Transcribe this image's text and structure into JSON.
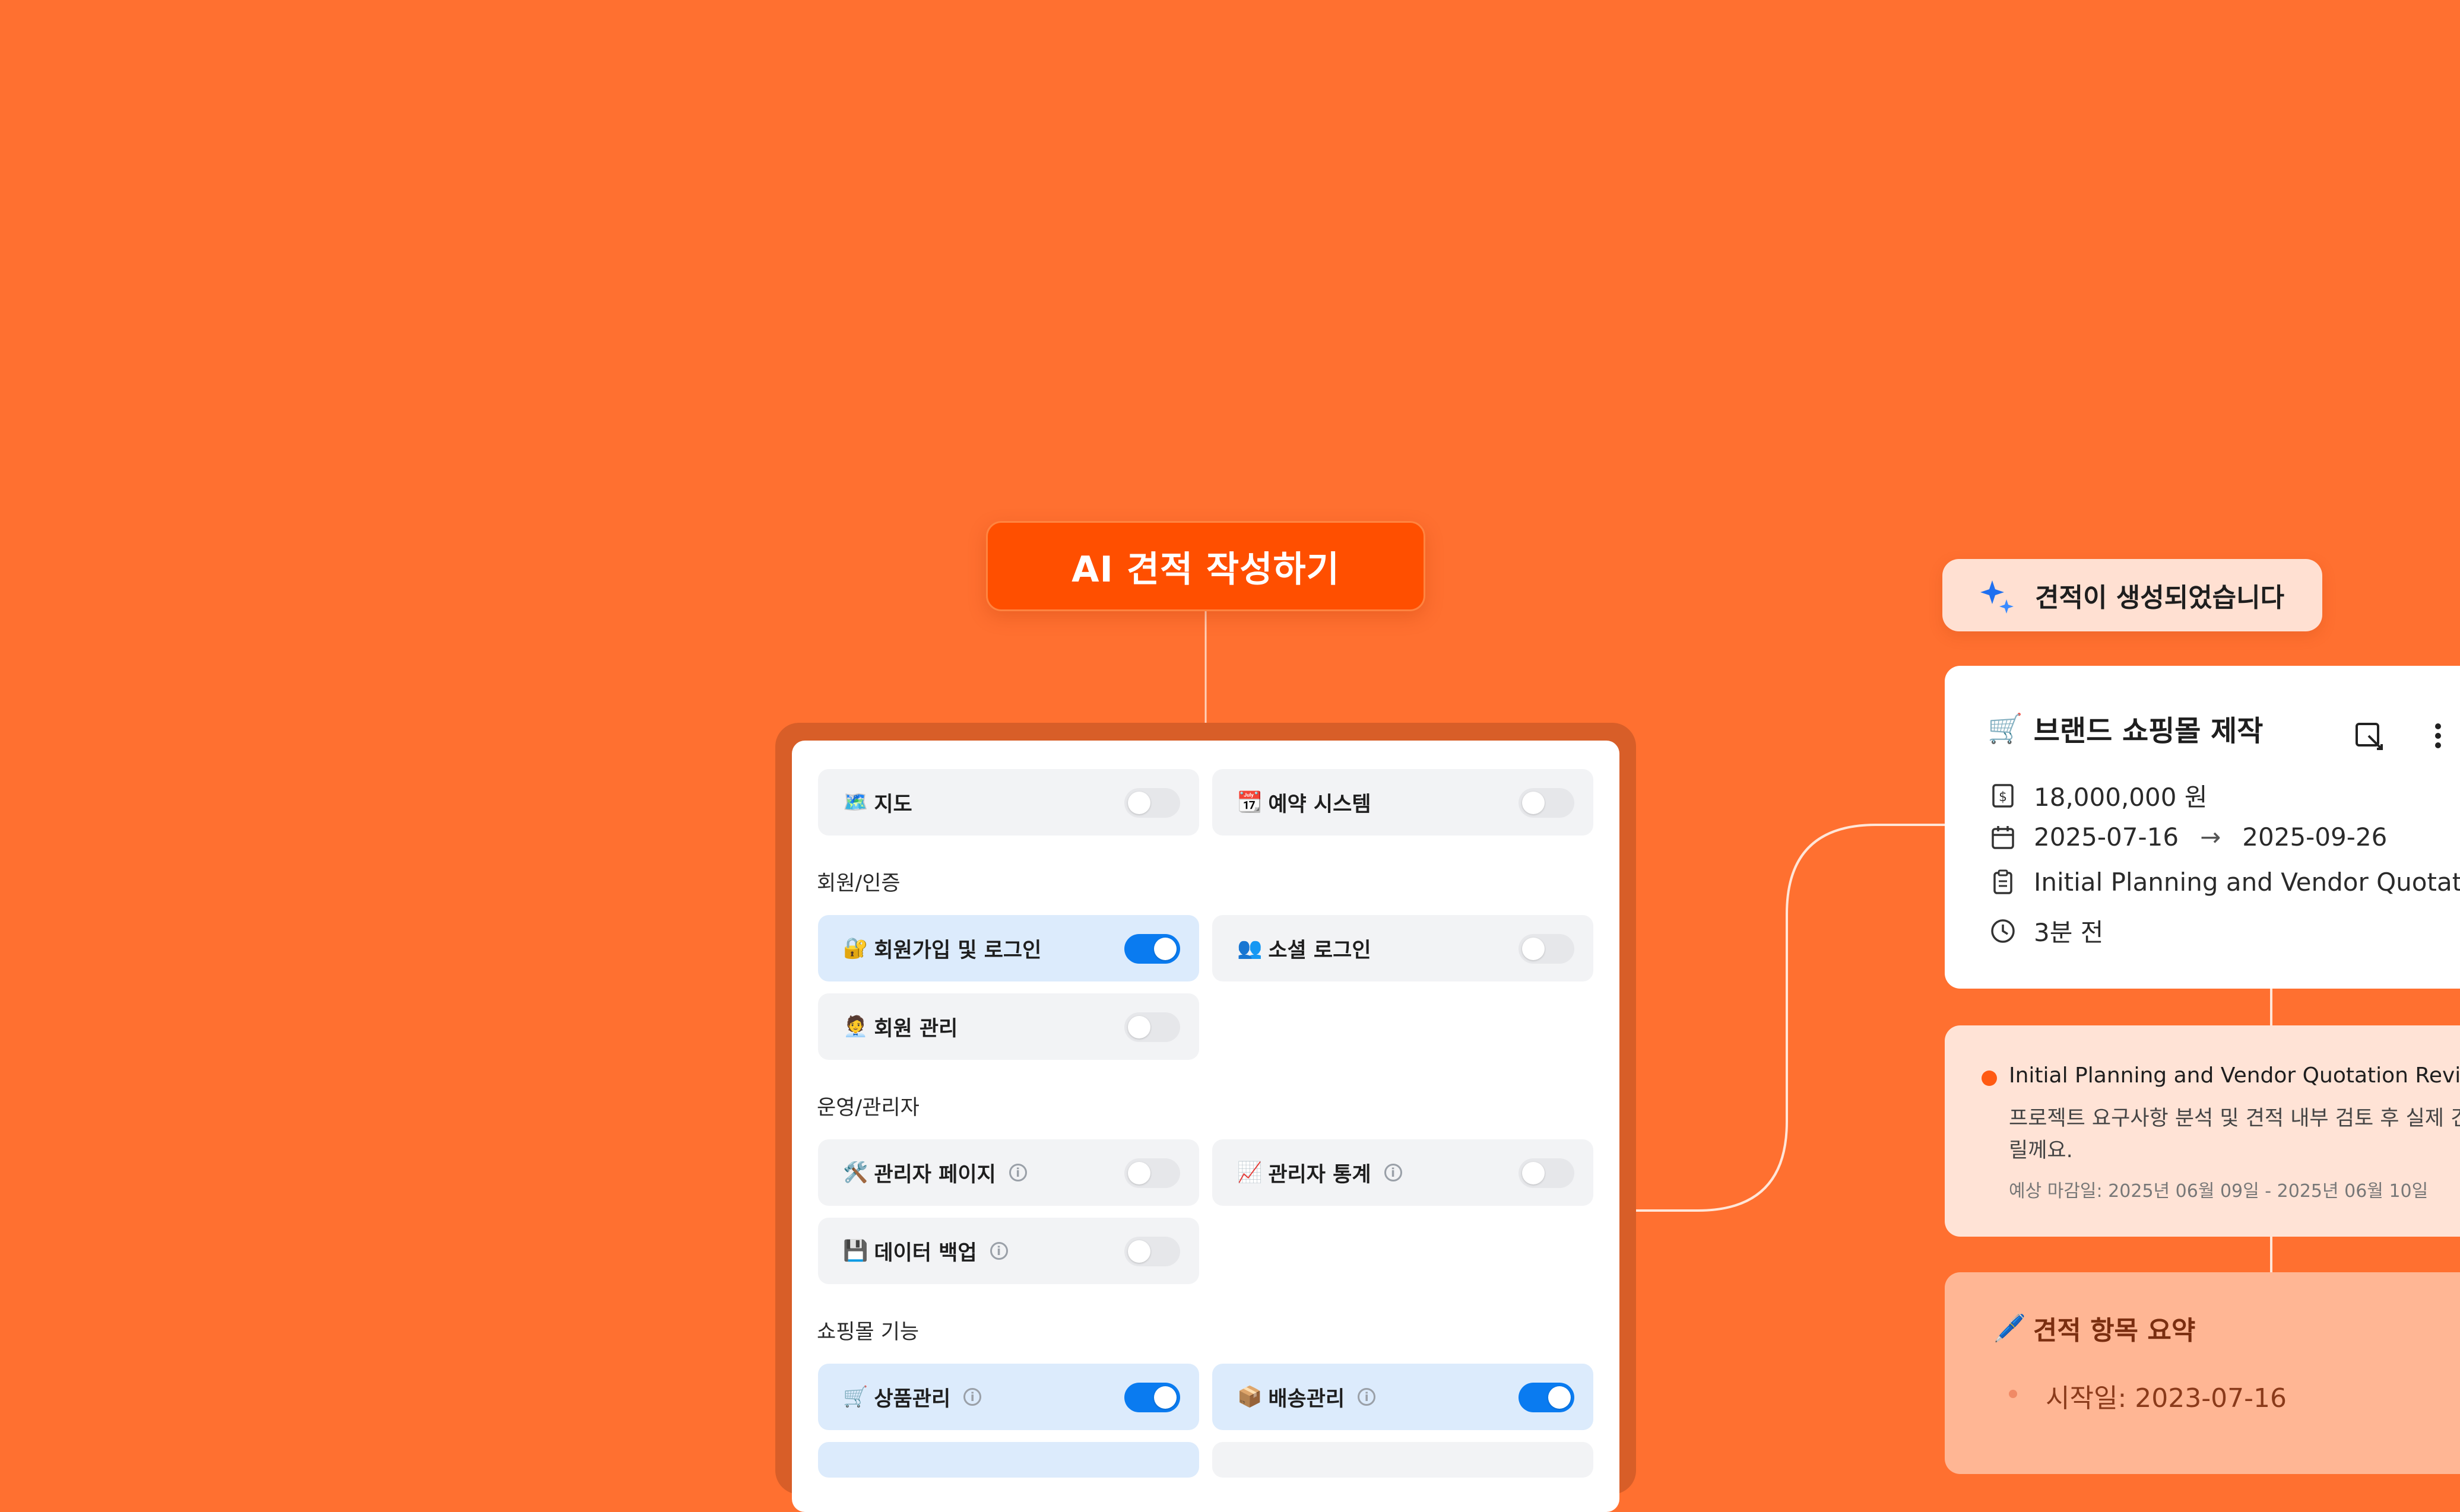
{
  "ai_button": {
    "label": "AI 견적 작성하기"
  },
  "features": {
    "tiles": [
      {
        "emoji": "🗺️",
        "label": "지도",
        "on": false,
        "info": false
      },
      {
        "emoji": "📆",
        "label": "예약 시스템",
        "on": false,
        "info": false
      },
      {
        "emoji": "🔐",
        "label": "회원가입 및 로그인",
        "on": true,
        "info": false
      },
      {
        "emoji": "👥",
        "label": "소셜 로그인",
        "on": false,
        "info": false
      },
      {
        "emoji": "🧑‍💼",
        "label": "회원 관리",
        "on": false,
        "info": false
      },
      {
        "emoji": "🛠️",
        "label": "관리자 페이지",
        "on": false,
        "info": true
      },
      {
        "emoji": "📈",
        "label": "관리자 통계",
        "on": false,
        "info": true
      },
      {
        "emoji": "💾",
        "label": "데이터 백업",
        "on": false,
        "info": true
      },
      {
        "emoji": "🛒",
        "label": "상품관리",
        "on": true,
        "info": true
      },
      {
        "emoji": "📦",
        "label": "배송관리",
        "on": true,
        "info": true
      }
    ],
    "sections": {
      "auth": "회원/인증",
      "admin": "운영/관리자",
      "shop": "쇼핑몰 기능"
    }
  },
  "toast": {
    "text": "견적이 생성되었습니다"
  },
  "quote_card": {
    "emoji": "🛒",
    "title": "브랜드 쇼핑몰 제작",
    "price": "18,000,000 원",
    "start_date": "2025-07-16",
    "end_date": "2025-09-26",
    "stage": "Initial Planning and Vendor Quotatio...",
    "updated": "3분 전"
  },
  "milestone": {
    "title": "Initial Planning and Vendor Quotation Review",
    "description": "프로젝트 요구사항 분석 및 견적 내부 검토 후 실제 견적 드릴께요.",
    "deadline": "예상 마감일: 2025년 06월 09일 - 2025년 06월 10일"
  },
  "summary": {
    "emoji": "🖊️",
    "title": "견적 항목 요약",
    "item": "시작일: 2023-07-16"
  },
  "colors": {
    "background": "#FF7030",
    "accent": "#FF4F00",
    "toggle_on": "#0A7BF0",
    "tile_on": "#DCEBFC",
    "tile_off": "#F2F3F5"
  }
}
